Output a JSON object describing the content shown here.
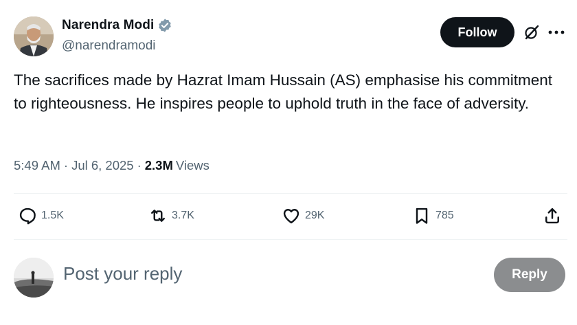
{
  "author": {
    "display_name": "Narendra Modi",
    "handle": "@narendramodi",
    "verified": true,
    "verified_icon": "verified-badge-icon",
    "verified_color": "#829aab"
  },
  "header": {
    "follow_label": "Follow",
    "grok_icon": "grok-icon",
    "more_icon": "more-icon"
  },
  "tweet": {
    "text": "The sacrifices made by Hazrat Imam Hussain (AS) emphasise his commitment to righteousness. He inspires people to uphold truth in the face of adversity.",
    "time": "5:49 AM",
    "date": "Jul 6, 2025",
    "separator": "·",
    "views_count": "2.3M",
    "views_label": "Views"
  },
  "actions": {
    "replies": {
      "icon": "reply-icon",
      "count": "1.5K"
    },
    "reposts": {
      "icon": "repost-icon",
      "count": "3.7K"
    },
    "likes": {
      "icon": "heart-icon",
      "count": "29K"
    },
    "bookmarks": {
      "icon": "bookmark-icon",
      "count": "785"
    },
    "share": {
      "icon": "share-icon"
    }
  },
  "composer": {
    "placeholder": "Post your reply",
    "reply_label": "Reply"
  },
  "colors": {
    "text_primary": "#0f1419",
    "text_secondary": "#536471",
    "follow_bg": "#0f1419",
    "reply_disabled_bg": "#8b8d8f",
    "divider": "#eff3f4"
  }
}
